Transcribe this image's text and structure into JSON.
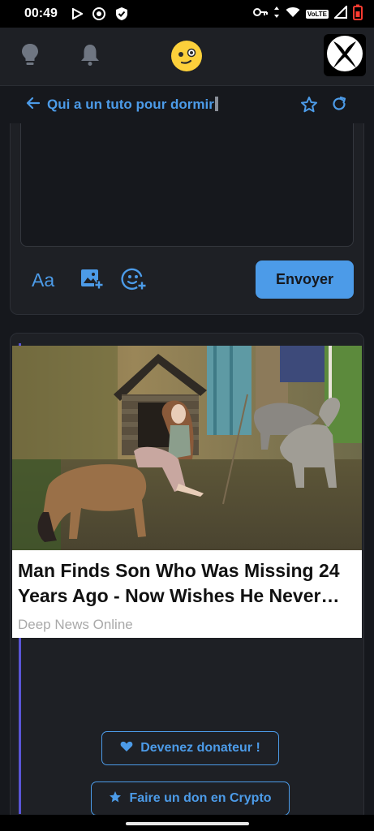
{
  "status_bar": {
    "time": "00:49",
    "icons": [
      "play-store-icon",
      "chrome-icon",
      "shield-icon",
      "vpn-key-icon",
      "data-arrows-icon",
      "wifi-icon",
      "volte-badge",
      "signal-icon",
      "battery-low-icon"
    ],
    "volte_label": "VoLTE"
  },
  "topbar": {
    "icons": [
      "lightbulb-icon",
      "bell-icon",
      "emoji-face-icon",
      "xbox-logo-icon"
    ]
  },
  "thread": {
    "title": "Qui a un tuto pour dormir",
    "icons": [
      "back-arrow-icon",
      "star-icon",
      "refresh-icon"
    ]
  },
  "composer": {
    "input_value": "",
    "format_label": "Aa",
    "icons": [
      "add-image-icon",
      "add-sticker-icon"
    ],
    "send_label": "Envoyer"
  },
  "ad": {
    "title": "Man Finds Son Who Was Missing 24 Years Ago - Now Wishes He Never…",
    "source": "Deep News Online"
  },
  "actions": {
    "donor_label": "Devenez donateur !",
    "crypto_label": "Faire un don en Crypto"
  },
  "colors": {
    "accent": "#4c9be8",
    "background": "#16181d",
    "surface": "#1e2025",
    "quote_bar": "#5a55d6",
    "ad_background": "#ffffff"
  }
}
